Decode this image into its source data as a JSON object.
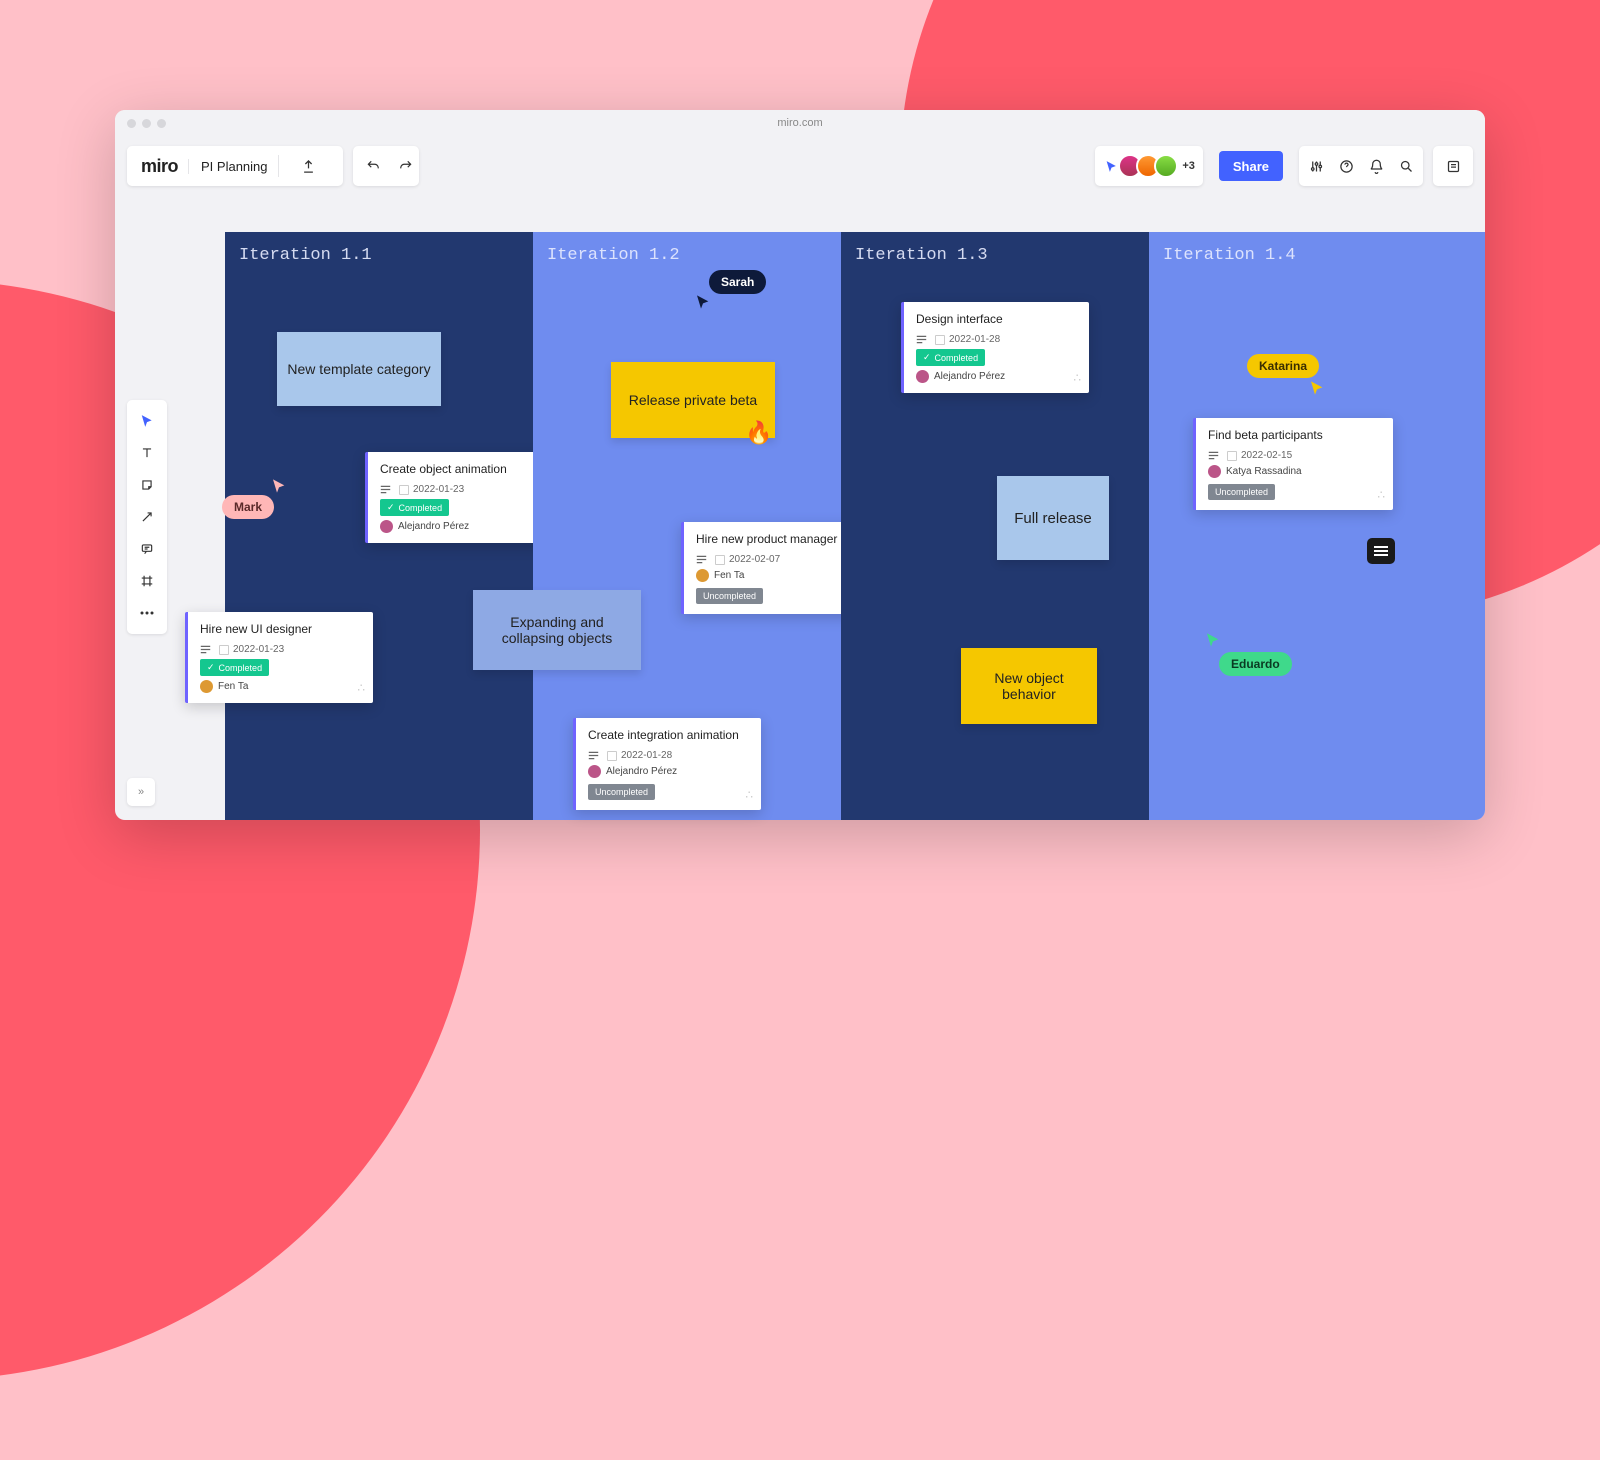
{
  "browser": {
    "url": "miro.com"
  },
  "app": {
    "logo": "miro",
    "board_name": "PI Planning",
    "share_label": "Share",
    "more_avatars": "+3"
  },
  "columns": [
    {
      "title": "Iteration 1.1"
    },
    {
      "title": "Iteration 1.2"
    },
    {
      "title": "Iteration 1.3"
    },
    {
      "title": "Iteration 1.4"
    }
  ],
  "stickies": {
    "new_template": "New template category",
    "release_beta": "Release private beta",
    "expanding": "Expanding and collapsing objects",
    "full_release": "Full release",
    "new_object": "New object behavior"
  },
  "cards": {
    "create_object": {
      "title": "Create object animation",
      "date": "2022-01-23",
      "status": "Completed",
      "assignee": "Alejandro Pérez"
    },
    "hire_ui": {
      "title": "Hire new UI designer",
      "date": "2022-01-23",
      "status": "Completed",
      "assignee": "Fen Ta"
    },
    "hire_pm": {
      "title": "Hire new product manager",
      "date": "2022-02-07",
      "status": "Uncompleted",
      "assignee": "Fen Ta"
    },
    "create_integration": {
      "title": "Create integration animation",
      "date": "2022-01-28",
      "status": "Uncompleted",
      "assignee": "Alejandro Pérez"
    },
    "design_interface": {
      "title": "Design interface",
      "date": "2022-01-28",
      "status": "Completed",
      "assignee": "Alejandro Pérez"
    },
    "find_beta": {
      "title": "Find beta participants",
      "date": "2022-02-15",
      "status": "Uncompleted",
      "assignee": "Katya Rassadina"
    }
  },
  "cursors": {
    "sarah": "Sarah",
    "mark": "Mark",
    "katarina": "Katarina",
    "eduardo": "Eduardo"
  },
  "status_labels": {
    "completed": "Completed",
    "uncompleted": "Uncompleted"
  }
}
